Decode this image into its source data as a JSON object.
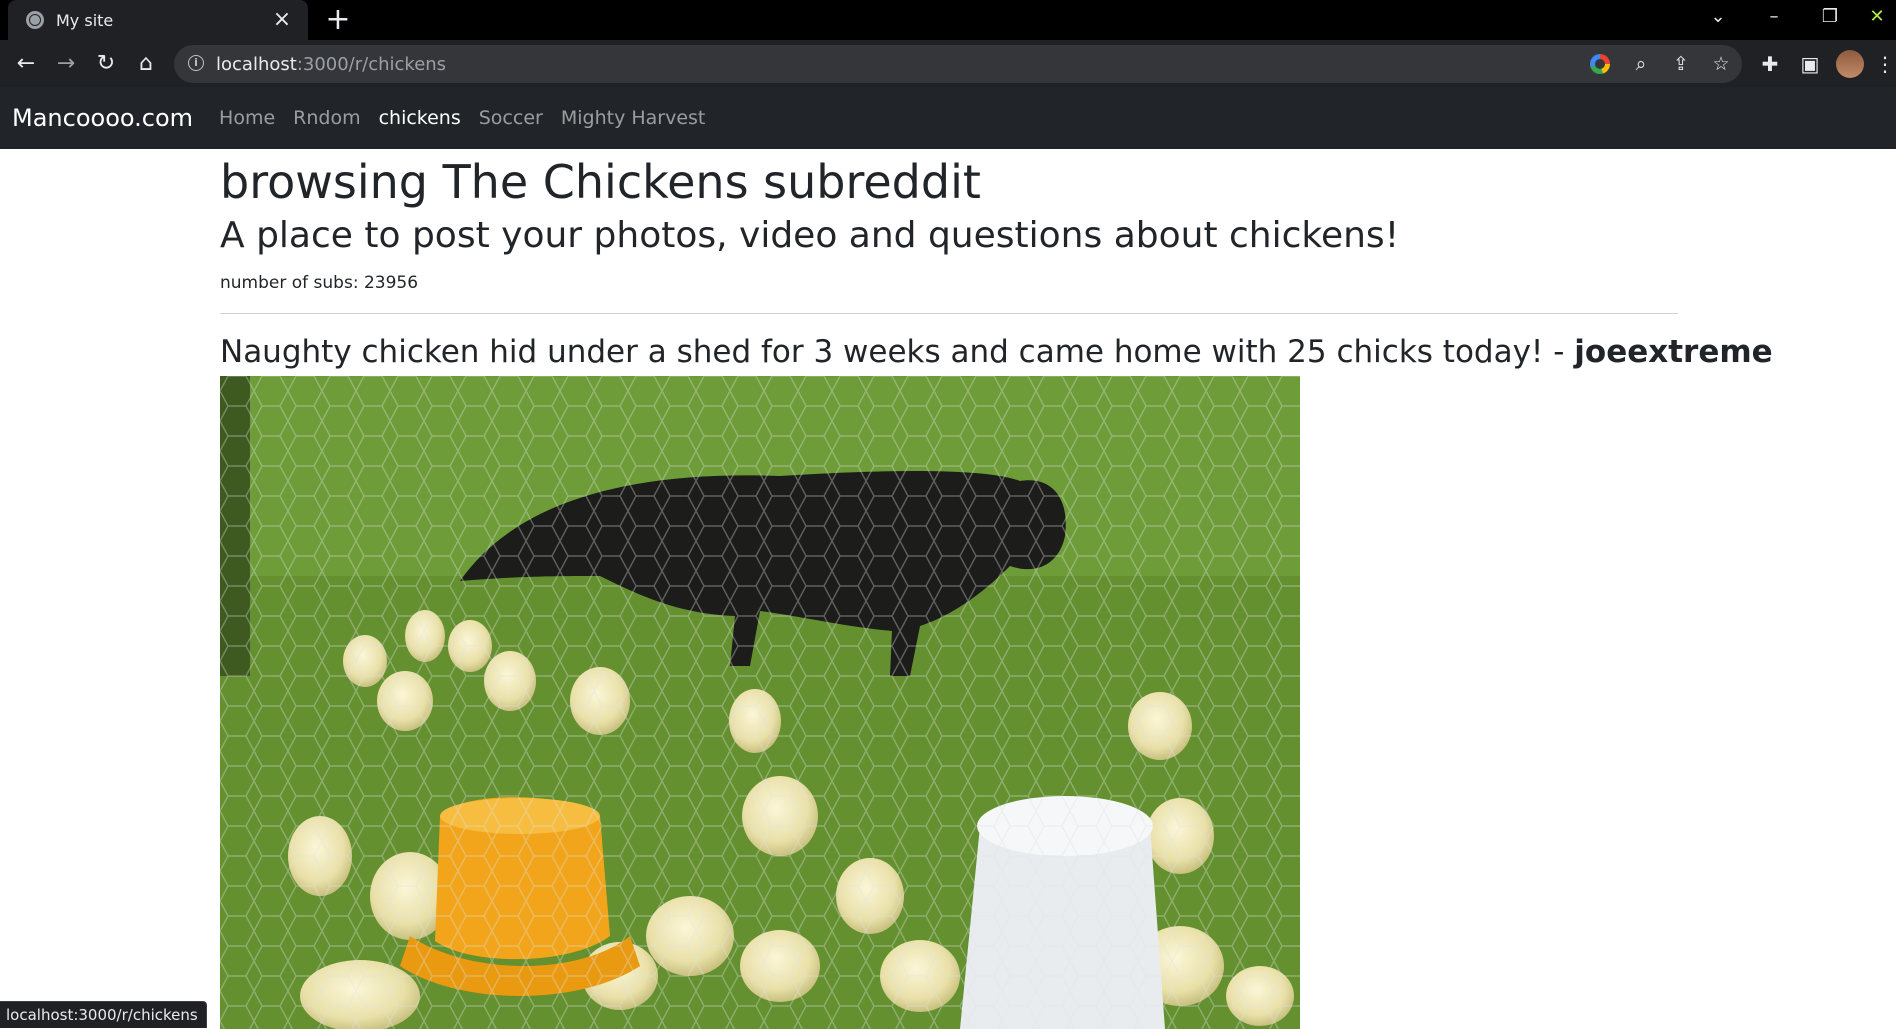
{
  "browser": {
    "tab_title": "My site",
    "url_host": "localhost",
    "url_path": ":3000/r/chickens",
    "status_url": "localhost:3000/r/chickens"
  },
  "navbar": {
    "brand": "Mancoooo.com",
    "links": [
      {
        "label": "Home",
        "active": false
      },
      {
        "label": "Rndom",
        "active": false
      },
      {
        "label": "chickens",
        "active": true
      },
      {
        "label": "Soccer",
        "active": false
      },
      {
        "label": "Mighty Harvest",
        "active": false
      }
    ]
  },
  "page": {
    "title": "browsing The Chickens subreddit",
    "subtitle": "A place to post your photos, video and questions about chickens!",
    "subs_label": "number of subs: 23956"
  },
  "post": {
    "title": "Naughty chicken hid under a shed for 3 weeks and came home with 25 chicks today! -",
    "author": "joeextreme"
  },
  "colors": {
    "chrome_dark": "#202124",
    "navbar_bg": "#212529",
    "nav_active": "#ffffff",
    "nav_inactive": "rgba(255,255,255,.55)"
  }
}
